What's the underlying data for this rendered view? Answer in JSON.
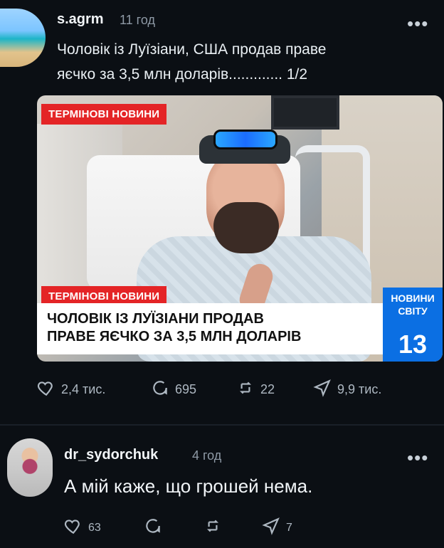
{
  "post": {
    "username": "s.agrm",
    "time": "11 год",
    "more": "•••",
    "lines": [
      "Чоловік із Луїзіани, США продав праве",
      "яєчко за 3,5 млн доларів............. 1/2"
    ],
    "media": {
      "tag_top": "ТЕРМІНОВІ НОВИНИ",
      "tag_bottom": "ТЕРМІНОВІ НОВИНИ",
      "headline_1": "ЧОЛОВІК ІЗ ЛУЇЗІАНИ ПРОДАВ",
      "headline_2": "ПРАВЕ ЯЄЧКО ЗА 3,5 МЛН ДОЛАРІВ",
      "brand_1": "НОВИНИ",
      "brand_2": "СВІТУ",
      "channel": "13"
    },
    "actions": {
      "likes": "2,4 тис.",
      "comments": "695",
      "reposts": "22",
      "shares": "9,9 тис."
    },
    "icons": {
      "like": "heart-outline-icon",
      "comment": "comment-bubble-icon",
      "repost": "repost-arrows-icon",
      "share": "send-paper-plane-icon",
      "more": "ellipsis-icon"
    }
  },
  "comment": {
    "username": "dr_sydorchuk",
    "time": "4 год",
    "more": "•••",
    "text": "А мій каже, що грошей нема.",
    "actions": {
      "likes": "63",
      "comments": "",
      "reposts": "",
      "shares": "7"
    }
  },
  "colors": {
    "background": "#0b0f14",
    "text_primary": "#e9eef2",
    "text_secondary": "#8e99a5",
    "breaking_red": "#e42426",
    "brand_blue": "#0b6fe3"
  }
}
